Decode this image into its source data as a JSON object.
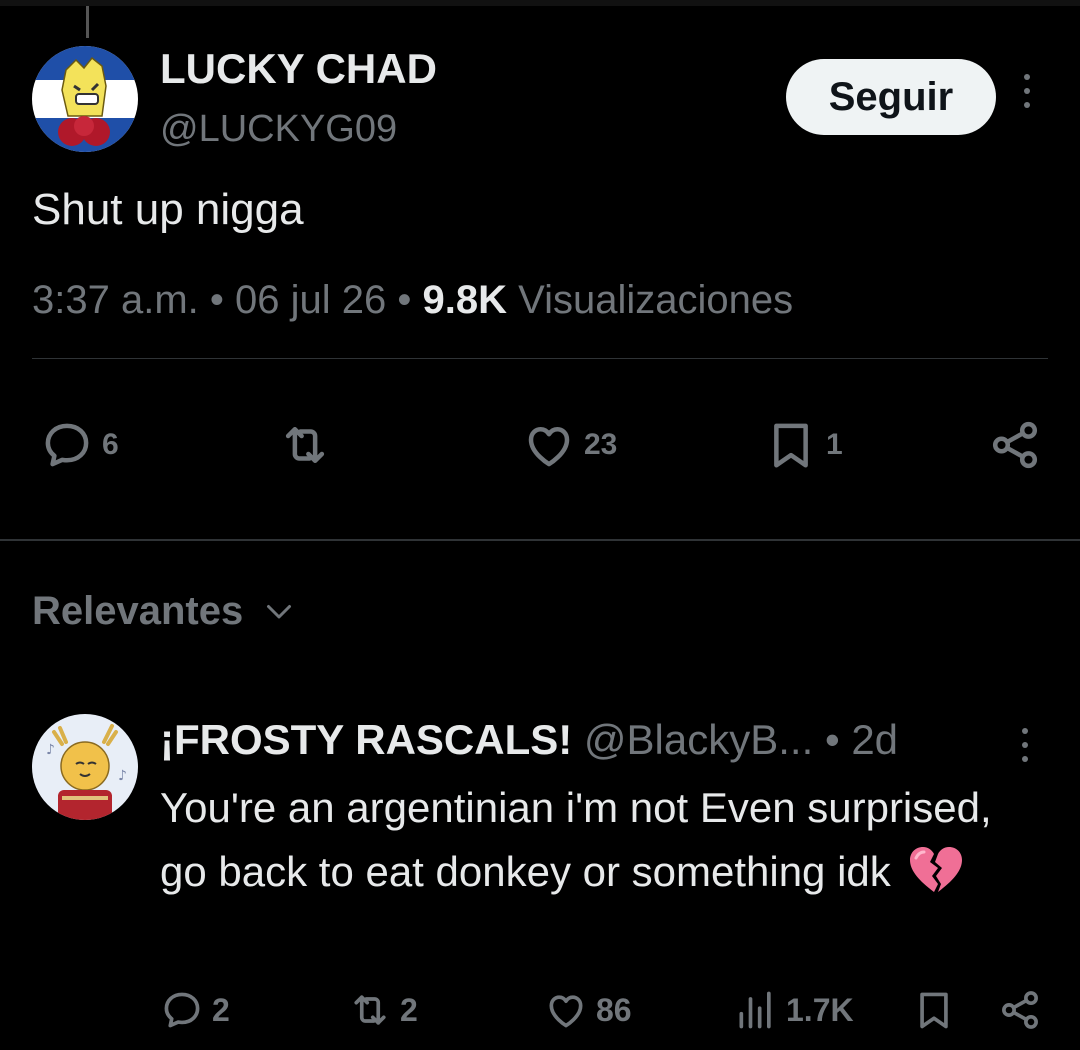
{
  "post": {
    "display_name": "LUCKY CHAD",
    "handle": "@LUCKYG09",
    "follow_label": "Seguir",
    "text": "Shut up nigga",
    "time": "3:37 a.m.",
    "date": "06 jul 26",
    "views_count": "9.8K",
    "views_label": "Visualizaciones",
    "actions": {
      "replies": "6",
      "reposts": "",
      "likes": "23",
      "bookmarks": "1"
    }
  },
  "sort": {
    "label": "Relevantes"
  },
  "reply": {
    "display_name": "¡FROSTY RASCALS!",
    "handle": "@BlackyB...",
    "age": "2d",
    "text": "You're an argentinian i'm not Even surprised, go back to eat donkey or something idk",
    "emoji": "broken-heart",
    "actions": {
      "replies": "2",
      "reposts": "2",
      "likes": "86",
      "views": "1.7K"
    }
  },
  "colors": {
    "background": "#000000",
    "text_primary": "#e7e9ea",
    "text_secondary": "#71767b",
    "follow_button_bg": "#eff3f4",
    "divider": "#2f3336"
  },
  "icons": [
    "reply-icon",
    "repost-icon",
    "like-icon",
    "bookmark-icon",
    "share-icon",
    "views-icon",
    "more-icon",
    "chevron-down-icon"
  ]
}
